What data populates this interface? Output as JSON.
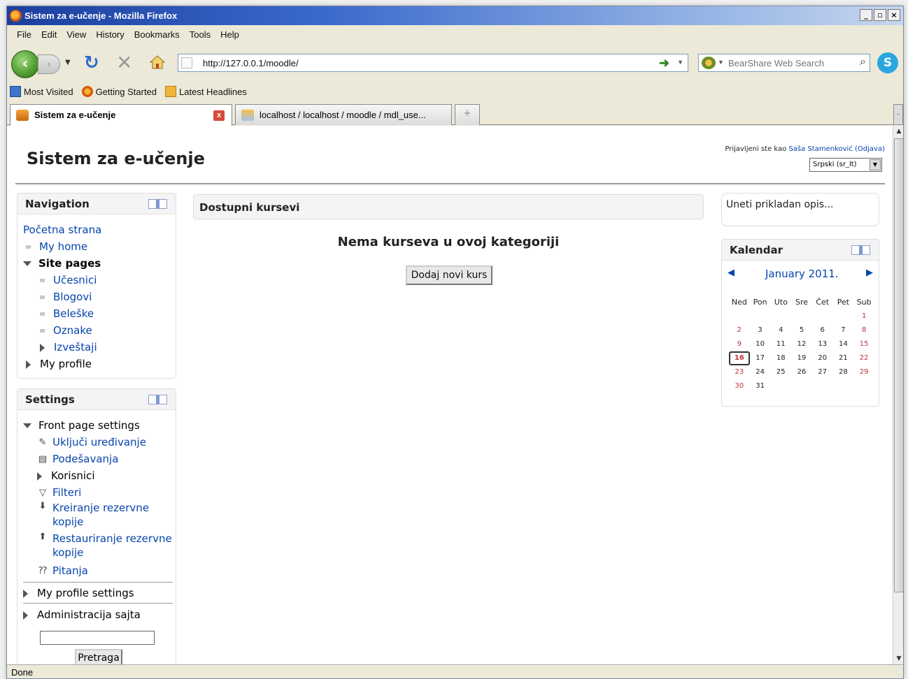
{
  "window": {
    "title": "Sistem za e-učenje - Mozilla Firefox"
  },
  "menu": [
    "File",
    "Edit",
    "View",
    "History",
    "Bookmarks",
    "Tools",
    "Help"
  ],
  "toolbar": {
    "url": "http://127.0.0.1/moodle/",
    "search_placeholder": "BearShare Web Search"
  },
  "bookmarks": [
    "Most Visited",
    "Getting Started",
    "Latest Headlines"
  ],
  "tabs": [
    {
      "label": "Sistem za e-učenje"
    },
    {
      "label": "localhost / localhost / moodle / mdl_use..."
    }
  ],
  "status": "Done",
  "page": {
    "site_title": "Sistem za e-učenje",
    "login_prefix": "Prijavljeni ste kao",
    "user_name": "Saša Stamenković",
    "logout": "(Odjava)",
    "language": "Srpski (sr_lt)"
  },
  "navigation": {
    "title": "Navigation",
    "home": "Početna strana",
    "my_home": "My home",
    "site_pages": "Site pages",
    "items": [
      "Učesnici",
      "Blogovi",
      "Beleške",
      "Oznake"
    ],
    "reports": "Izveštaji",
    "my_profile": "My profile"
  },
  "settings": {
    "title": "Settings",
    "front_page": "Front page settings",
    "edit_on": "Uključi uređivanje",
    "settings": "Podešavanja",
    "users": "Korisnici",
    "filters": "Filteri",
    "backup_1": "Kreiranje rezervne",
    "backup_2": "kopije",
    "restore_1": "Restauriranje rezervne",
    "restore_2": "kopije",
    "questions": "Pitanja",
    "profile_settings": "My profile settings",
    "site_admin": "Administracija sajta",
    "search_button": "Pretraga"
  },
  "main": {
    "header": "Dostupni kursevi",
    "empty_message": "Nema kurseva u ovoj kategoriji",
    "add_course": "Dodaj novi kurs"
  },
  "description": "Uneti prikladan opis...",
  "calendar": {
    "title": "Kalendar",
    "month": "January 2011.",
    "weekdays": [
      "Ned",
      "Pon",
      "Uto",
      "Sre",
      "Čet",
      "Pet",
      "Sub"
    ],
    "weeks": [
      [
        "",
        "",
        "",
        "",
        "",
        "",
        "1"
      ],
      [
        "2",
        "3",
        "4",
        "5",
        "6",
        "7",
        "8"
      ],
      [
        "9",
        "10",
        "11",
        "12",
        "13",
        "14",
        "15"
      ],
      [
        "16",
        "17",
        "18",
        "19",
        "20",
        "21",
        "22"
      ],
      [
        "23",
        "24",
        "25",
        "26",
        "27",
        "28",
        "29"
      ],
      [
        "30",
        "31",
        "",
        "",
        "",
        "",
        ""
      ]
    ],
    "today": "16",
    "weekend_color": "#c0303a"
  }
}
